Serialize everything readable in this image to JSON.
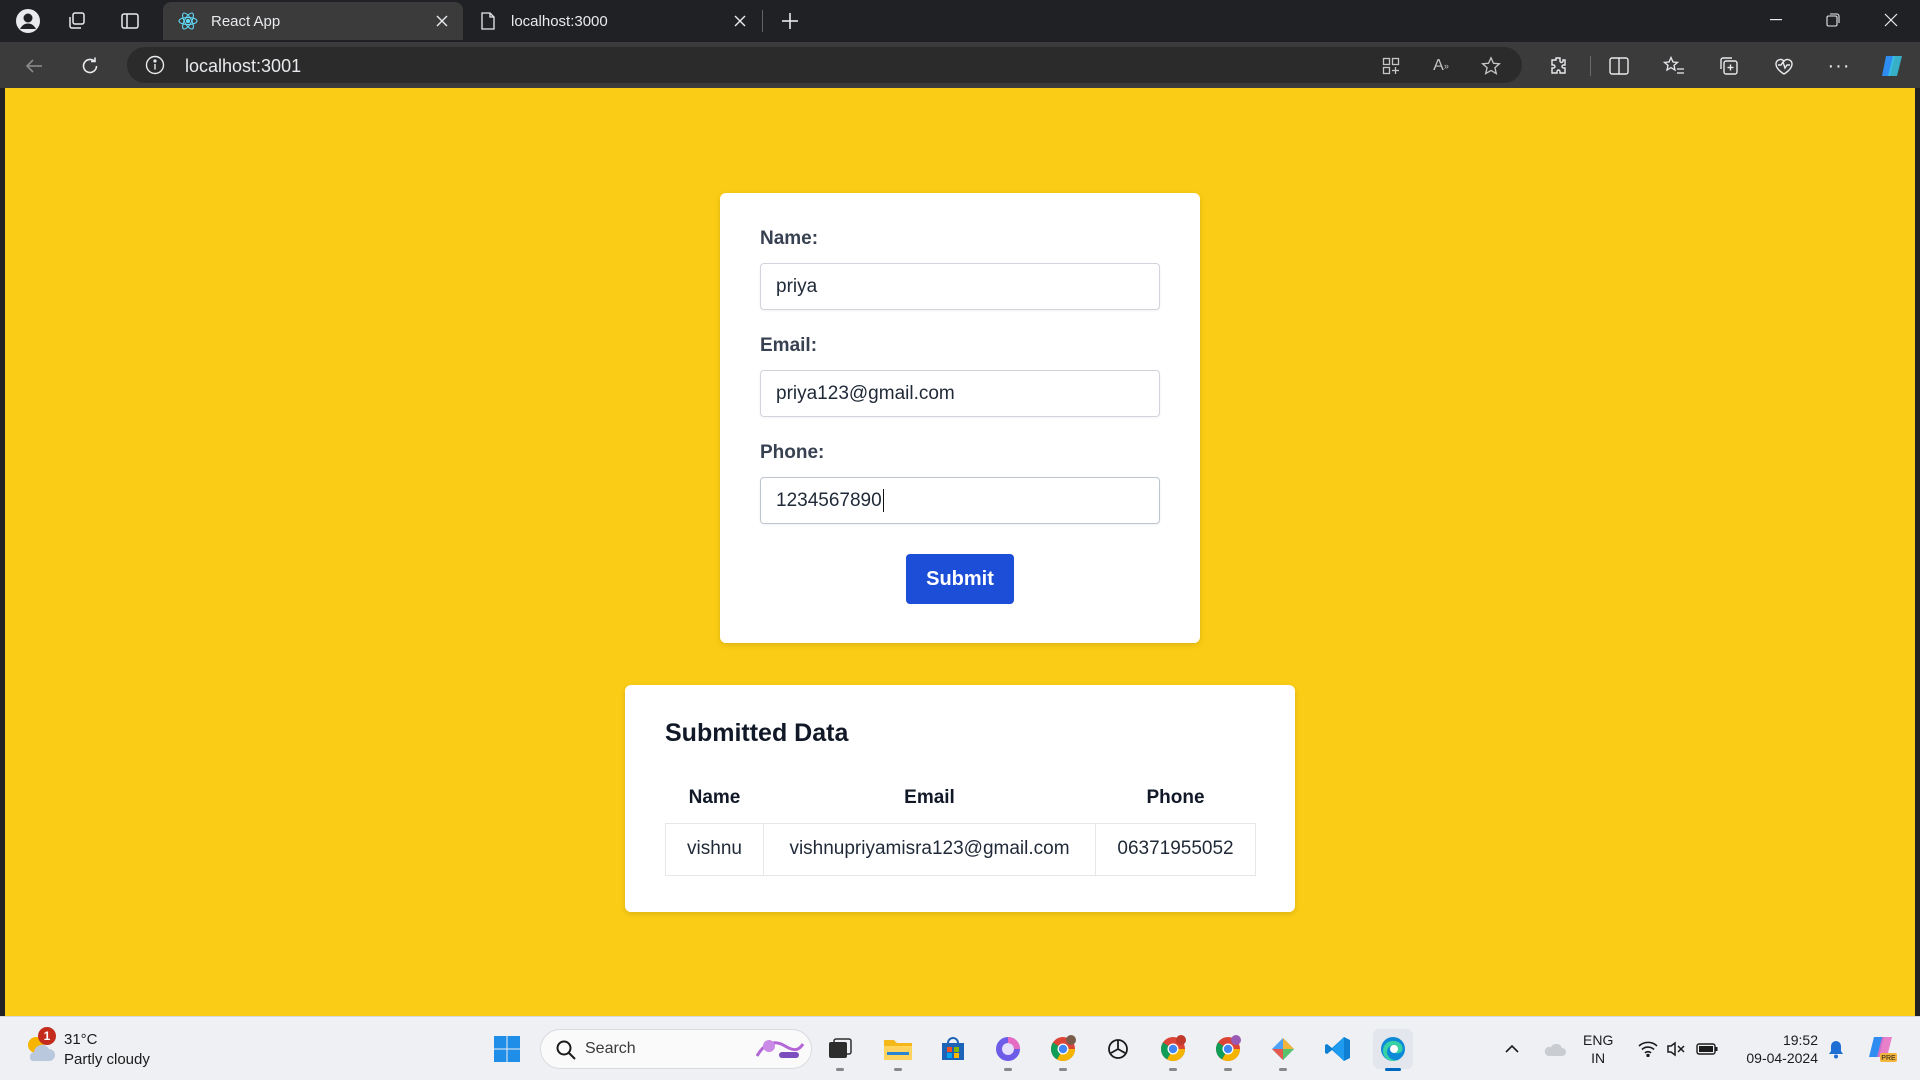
{
  "browser": {
    "tabs": [
      {
        "label": "React App",
        "active": true
      },
      {
        "label": "localhost:3000",
        "active": false
      }
    ],
    "url": "localhost:3001"
  },
  "form": {
    "name_label": "Name:",
    "name_value": "priya",
    "email_label": "Email:",
    "email_value": "priya123@gmail.com",
    "phone_label": "Phone:",
    "phone_value": "1234567890",
    "submit_label": "Submit"
  },
  "submitted": {
    "title": "Submitted Data",
    "headers": [
      "Name",
      "Email",
      "Phone"
    ],
    "rows": [
      [
        "vishnu",
        "vishnupriyamisra123@gmail.com",
        "06371955052"
      ]
    ]
  },
  "taskbar": {
    "weather_temp": "31°C",
    "weather_condition": "Partly cloudy",
    "weather_badge": "1",
    "search_placeholder": "Search",
    "lang_line1": "ENG",
    "lang_line2": "IN",
    "time": "19:52",
    "date": "09-04-2024"
  },
  "colors": {
    "page_background": "#facc15",
    "submit_button": "#1d4ed8"
  }
}
